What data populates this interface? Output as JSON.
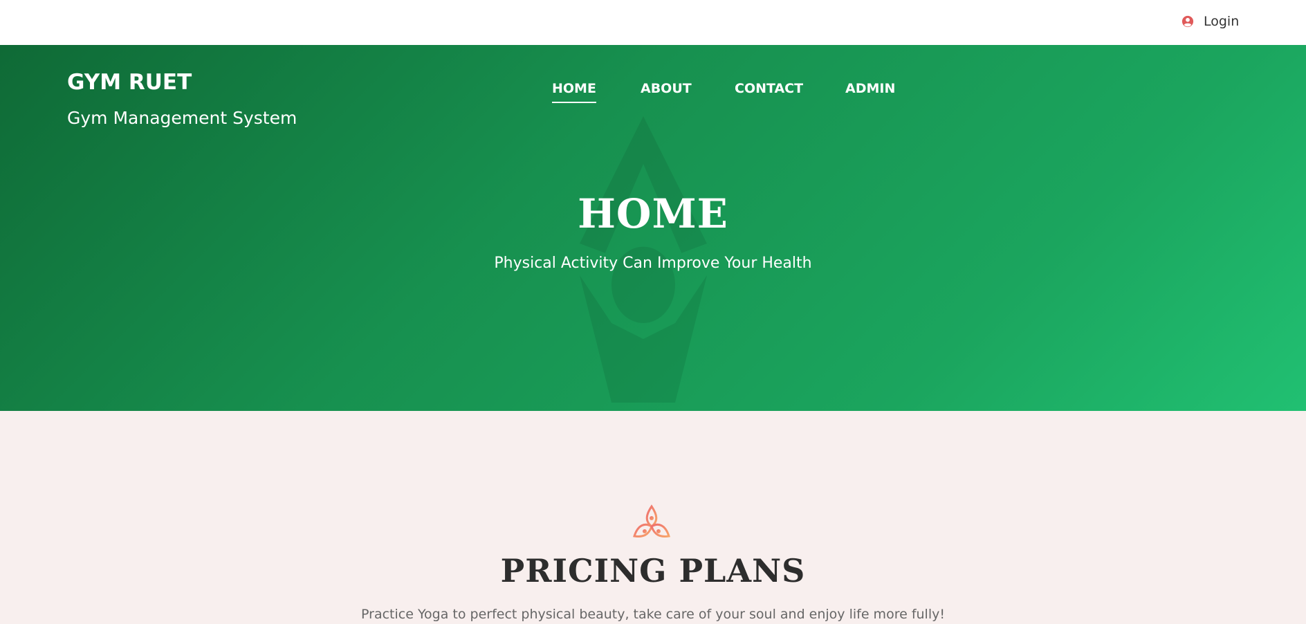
{
  "topbar": {
    "login_label": "Login",
    "login_icon": "user-circle-icon",
    "login_icon_color": "#e05a5a"
  },
  "brand": {
    "title": "GYM RUET",
    "subtitle": "Gym Management System"
  },
  "nav": {
    "items": [
      {
        "label": "HOME",
        "active": true
      },
      {
        "label": "ABOUT",
        "active": false
      },
      {
        "label": "CONTACT",
        "active": false
      },
      {
        "label": "ADMIN",
        "active": false
      }
    ]
  },
  "hero": {
    "title": "HOME",
    "subtitle": "Physical Activity Can Improve Your Health",
    "gradient_start": "#0f6a36",
    "gradient_end": "#21c072"
  },
  "pricing": {
    "icon": "lotus-icon",
    "icon_color": "#f0836a",
    "title": "PRICING PLANS",
    "text": "Practice Yoga to perfect physical beauty, take care of your soul and enjoy life more fully!"
  }
}
